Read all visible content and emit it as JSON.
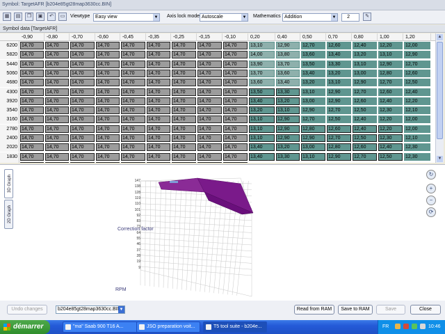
{
  "window": {
    "title": "Symbol: TargetAFR [b204e85gt28map3630cc.BIN]"
  },
  "toolbar": {
    "viewtype_label": "Viewtype",
    "viewtype_value": "Easy view",
    "axislock_label": "Axis lock mode",
    "axislock_value": "Autoscale",
    "math_label": "Mathematics",
    "math_value": "Addition",
    "math_operand": "2"
  },
  "symbol_header": "Symbol data [TargetAFR]",
  "table": {
    "columns": [
      "-0,90",
      "-0,80",
      "-0,70",
      "-0,60",
      "-0,45",
      "-0,35",
      "-0,25",
      "-0,15",
      "-0,10",
      "0,20",
      "0,40",
      "0,50",
      "0,70",
      "0,80",
      "1,00",
      "1,20"
    ],
    "rows": [
      {
        "rpm": "6200",
        "values": [
          "14,70",
          "14,70",
          "14,70",
          "14,70",
          "14,70",
          "14,70",
          "14,70",
          "14,70",
          "14,70",
          "13,10",
          "12,90",
          "12,70",
          "12,60",
          "12,40",
          "12,20",
          "12,00"
        ]
      },
      {
        "rpm": "5820",
        "values": [
          "14,70",
          "14,70",
          "14,70",
          "14,70",
          "14,70",
          "14,70",
          "14,70",
          "14,70",
          "14,70",
          "14,00",
          "13,80",
          "13,60",
          "13,40",
          "13,20",
          "13,10",
          "12,90"
        ]
      },
      {
        "rpm": "5440",
        "values": [
          "14,70",
          "14,70",
          "14,70",
          "14,70",
          "14,70",
          "14,70",
          "14,70",
          "14,70",
          "14,70",
          "13,90",
          "13,70",
          "13,50",
          "13,30",
          "13,10",
          "12,90",
          "12,70"
        ]
      },
      {
        "rpm": "5060",
        "values": [
          "14,70",
          "14,70",
          "14,70",
          "14,70",
          "14,70",
          "14,70",
          "14,70",
          "14,70",
          "14,70",
          "13,70",
          "13,60",
          "13,40",
          "13,20",
          "13,00",
          "12,80",
          "12,60"
        ]
      },
      {
        "rpm": "4680",
        "values": [
          "14,70",
          "14,70",
          "14,70",
          "14,70",
          "14,70",
          "14,70",
          "14,70",
          "14,70",
          "14,70",
          "13,60",
          "13,40",
          "13,20",
          "13,10",
          "12,90",
          "12,70",
          "12,50"
        ]
      },
      {
        "rpm": "4300",
        "values": [
          "14,70",
          "14,70",
          "14,70",
          "14,70",
          "14,70",
          "14,70",
          "14,70",
          "14,70",
          "14,70",
          "13,50",
          "13,30",
          "13,10",
          "12,90",
          "12,70",
          "12,60",
          "12,40"
        ]
      },
      {
        "rpm": "3920",
        "values": [
          "14,70",
          "14,70",
          "14,70",
          "14,70",
          "14,70",
          "14,70",
          "14,70",
          "14,70",
          "14,70",
          "13,40",
          "13,20",
          "13,00",
          "12,90",
          "12,60",
          "12,40",
          "12,20"
        ]
      },
      {
        "rpm": "3540",
        "values": [
          "14,70",
          "14,70",
          "14,70",
          "14,70",
          "14,70",
          "14,70",
          "14,70",
          "14,70",
          "14,70",
          "13,20",
          "13,10",
          "12,90",
          "12,70",
          "12,50",
          "12,30",
          "12,10"
        ]
      },
      {
        "rpm": "3160",
        "values": [
          "14,70",
          "14,70",
          "14,70",
          "14,70",
          "14,70",
          "14,70",
          "14,70",
          "14,70",
          "14,70",
          "13,10",
          "12,90",
          "12,70",
          "12,50",
          "12,40",
          "12,20",
          "12,00"
        ]
      },
      {
        "rpm": "2780",
        "values": [
          "14,70",
          "14,70",
          "14,70",
          "14,70",
          "14,70",
          "14,70",
          "14,70",
          "14,70",
          "14,70",
          "13,10",
          "12,90",
          "12,80",
          "12,60",
          "12,40",
          "12,20",
          "12,00"
        ]
      },
      {
        "rpm": "2400",
        "values": [
          "14,70",
          "14,70",
          "14,70",
          "14,70",
          "14,70",
          "14,70",
          "14,70",
          "14,70",
          "14,70",
          "13,10",
          "12,90",
          "12,90",
          "12,70",
          "12,50",
          "12,30",
          "12,10"
        ]
      },
      {
        "rpm": "2020",
        "values": [
          "14,70",
          "14,70",
          "14,70",
          "14,70",
          "14,70",
          "14,70",
          "14,70",
          "14,70",
          "14,70",
          "13,40",
          "13,20",
          "13,00",
          "12,80",
          "12,60",
          "12,40",
          "12,30"
        ]
      },
      {
        "rpm": "1830",
        "values": [
          "14,70",
          "14,70",
          "14,70",
          "14,70",
          "14,70",
          "14,70",
          "14,70",
          "14,70",
          "14,70",
          "13,40",
          "13,30",
          "13,10",
          "12,90",
          "12,70",
          "12,50",
          "12,30"
        ]
      },
      {
        "rpm": "",
        "values": [
          "14,70",
          "14,70",
          "14,70",
          "14,70",
          "14,70",
          "14,70",
          "14,70",
          "14,70",
          "14,70",
          "",
          "",
          "",
          "",
          "",
          "",
          ""
        ]
      }
    ]
  },
  "graph": {
    "tab_3d": "3D Graph",
    "tab_2d": "2D Graph",
    "z_label": "Correction factor",
    "x_label": "RPM",
    "z_ticks": [
      "147",
      "138",
      "128",
      "119",
      "110",
      "101",
      "92",
      "83",
      "73",
      "64",
      "55",
      "46",
      "37",
      "28",
      "19",
      "9"
    ]
  },
  "bottom": {
    "undo_label": "Undo changes",
    "file_value": "b204e85gt28map3630cc.BIN",
    "read_ram_label": "Read from RAM",
    "save_ram_label": "Save to RAM",
    "save_label": "Save",
    "close_label": "Close"
  },
  "taskbar": {
    "start_label": "démarrer",
    "tasks": [
      "\"ma\" Saab 900 T16 A...",
      "JSO preparation voit...",
      "T5 tool suite - b204e..."
    ],
    "lang": "FR",
    "clock": "10:46"
  },
  "colors": {
    "teal_cell": "#5f9690",
    "grey_cell": "#9c9c9c",
    "surface": "#7a1a8a",
    "taskbar": "#245ad8"
  }
}
